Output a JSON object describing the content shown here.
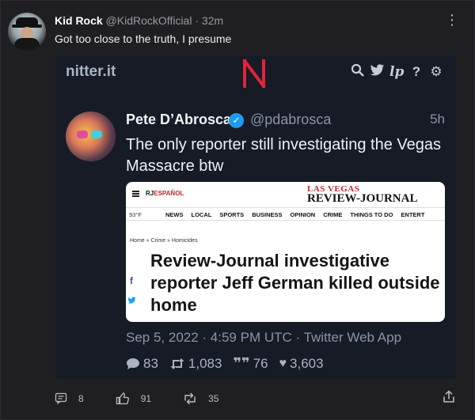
{
  "post": {
    "author_name": "Kid Rock",
    "author_handle": "@KidRockOfficial",
    "time": "· 32m",
    "text": "Got too close to the truth, I presume",
    "more_icon": "more-icon"
  },
  "embed": {
    "brand": "nitter.it",
    "logo_letter": "N",
    "nav_icons": [
      "search-icon",
      "bird-icon",
      "lp-icon",
      "help-icon",
      "gear-icon"
    ],
    "tweet": {
      "name": "Pete D’Abrosca",
      "verified": "✓",
      "handle": "@pdabrosca",
      "time": "5h",
      "text": "The only reporter still investigating the Vegas Massacre btw",
      "date": "Sep 5, 2022 · 4:59 PM UTC · Twitter Web App",
      "stats": {
        "replies": "83",
        "retweets": "1,083",
        "quotes": "76",
        "likes": "3,603"
      }
    },
    "article": {
      "rj": "RJ",
      "espanol": "ESPAÑOL",
      "logo_top": "LAS VEGAS",
      "logo_bottom": "REVIEW-JOURNAL",
      "temp": "93°F",
      "nav": [
        "NEWS",
        "LOCAL",
        "SPORTS",
        "BUSINESS",
        "OPINION",
        "CRIME",
        "THINGS TO DO",
        "ENTERT"
      ],
      "breadcrumb": "Home » Crime » Homicides",
      "headline": "Review-Journal investigative reporter Jeff German killed outside home",
      "share_fb": "f",
      "share_tw": "t"
    }
  },
  "actions": {
    "comments": "8",
    "likes": "91",
    "reposts": "35"
  },
  "colors": {
    "background": "#1f1f23",
    "embed_bg": "#161b26",
    "nitter_red": "#e0243a",
    "verified_blue": "#1d9bf0",
    "rj_red": "#c0292b"
  }
}
